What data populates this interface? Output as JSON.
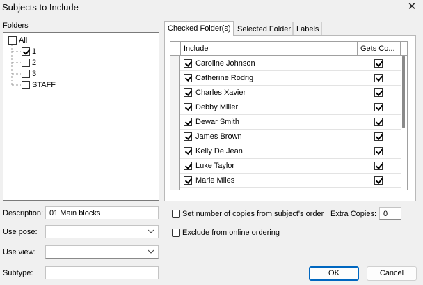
{
  "window": {
    "title": "Subjects to Include",
    "close_glyph": "✕"
  },
  "folders": {
    "label": "Folders",
    "root": {
      "label": "All",
      "checked": false
    },
    "items": [
      {
        "label": "1",
        "checked": true
      },
      {
        "label": "2",
        "checked": false
      },
      {
        "label": "3",
        "checked": false
      },
      {
        "label": "STAFF",
        "checked": false
      }
    ]
  },
  "tabs": [
    {
      "label": "Checked Folder(s)",
      "active": true
    },
    {
      "label": "Selected Folder",
      "active": false
    },
    {
      "label": "Labels",
      "active": false
    }
  ],
  "grid": {
    "columns": [
      "Include",
      "Gets Co..."
    ],
    "rows": [
      {
        "name": "Caroline Johnson",
        "include": true,
        "gets_copies": true
      },
      {
        "name": "Catherine Rodrig",
        "include": true,
        "gets_copies": true
      },
      {
        "name": "Charles Xavier",
        "include": true,
        "gets_copies": true
      },
      {
        "name": "Debby Miller",
        "include": true,
        "gets_copies": true
      },
      {
        "name": "Dewar Smith",
        "include": true,
        "gets_copies": true
      },
      {
        "name": "James Brown",
        "include": true,
        "gets_copies": true
      },
      {
        "name": "Kelly De Jean",
        "include": true,
        "gets_copies": true
      },
      {
        "name": "Luke  Taylor",
        "include": true,
        "gets_copies": true
      },
      {
        "name": "Marie Miles",
        "include": true,
        "gets_copies": true
      }
    ]
  },
  "form": {
    "description_label": "Description:",
    "description_value": "01 Main blocks",
    "use_pose_label": "Use pose:",
    "use_pose_value": "",
    "use_view_label": "Use view:",
    "use_view_value": "",
    "subtype_label": "Subtype:",
    "subtype_value": ""
  },
  "options": {
    "set_copies_label": "Set number of copies from subject's order",
    "set_copies_checked": false,
    "extra_copies_label": "Extra Copies:",
    "extra_copies_value": "0",
    "exclude_online_label": "Exclude from online ordering",
    "exclude_online_checked": false
  },
  "buttons": {
    "ok": "OK",
    "cancel": "Cancel"
  }
}
